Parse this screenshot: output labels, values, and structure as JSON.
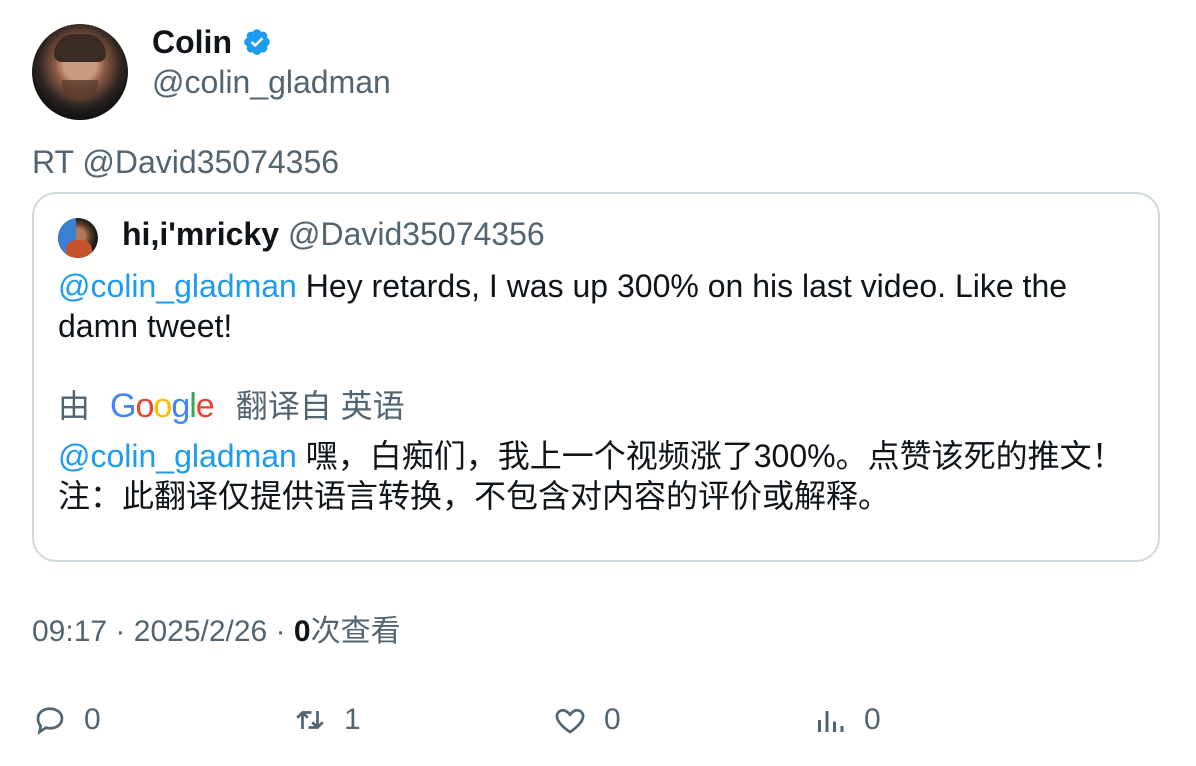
{
  "author": {
    "name": "Colin",
    "handle": "@colin_gladman"
  },
  "retweet_label": "RT @David35074356",
  "quoted": {
    "name": "hi,i'mricky",
    "handle": "@David35074356",
    "mention": "@colin_gladman",
    "text": " Hey retards, I was up 300% on his last video. Like the damn tweet!",
    "translation_prefix": "由",
    "translation_provider": "Google",
    "translation_suffix": "翻译自 英语",
    "translated_mention": "@colin_gladman",
    "translated_text": " 嘿，白痴们，我上一个视频涨了300%。点赞该死的推文！注：此翻译仅提供语言转换，不包含对内容的评价或解释。"
  },
  "meta": {
    "time": "09:17",
    "separator": "·",
    "date": "2025/2/26",
    "views_count": "0",
    "views_label": "次查看"
  },
  "actions": {
    "reply_count": "0",
    "retweet_count": "1",
    "like_count": "0",
    "views_count": "0"
  },
  "colors": {
    "link": "#1d9bf0",
    "muted": "#536471",
    "text": "#0f1419",
    "border": "#cfd9de"
  }
}
